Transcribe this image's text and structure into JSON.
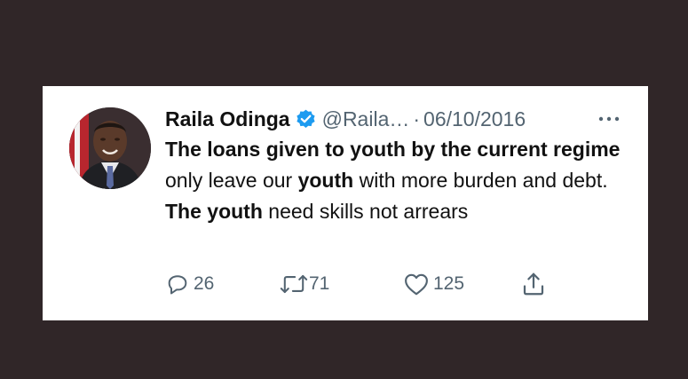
{
  "tweet": {
    "author_name": "Raila Odinga",
    "handle": "@Raila…",
    "separator": "·",
    "date": "06/10/2016",
    "body": [
      {
        "text": "The loans given to youth by the current regime",
        "bold": true
      },
      {
        "text": " only leave our ",
        "bold": false
      },
      {
        "text": "youth",
        "bold": true
      },
      {
        "text": " with more burden and debt. ",
        "bold": false
      },
      {
        "text": "The youth",
        "bold": true
      },
      {
        "text": " need skills not arrears",
        "bold": false
      }
    ],
    "replies": "26",
    "retweets": "71",
    "likes": "125"
  },
  "icons": {
    "verified": "verified-badge-icon",
    "more": "more-icon",
    "reply": "reply-icon",
    "retweet": "retweet-icon",
    "like": "heart-icon",
    "share": "share-icon"
  },
  "colors": {
    "background": "#302628",
    "card": "#ffffff",
    "text": "#111111",
    "muted": "#536471",
    "verified": "#1d9bf0"
  }
}
